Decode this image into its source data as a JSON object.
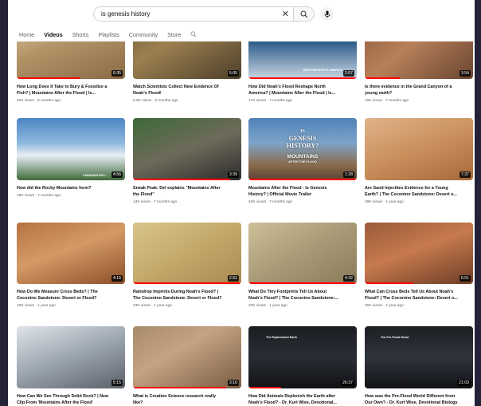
{
  "search": {
    "query": "is genesis history"
  },
  "tabs": [
    "Home",
    "Videos",
    "Shorts",
    "Playlists",
    "Community",
    "Store"
  ],
  "videos": [
    {
      "duration": "6:35",
      "title1": "How Long Does It Take to Bury & Fossilize a",
      "title2": "Fish? | Mountains After the Flood | Is...",
      "views": "40K views",
      "age": "6 months ago"
    },
    {
      "duration": "5:05",
      "title1": "Watch Scientists Collect New Evidence Of",
      "title2": "Noah's Flood!",
      "views": "6.9K views",
      "age": "6 months ago"
    },
    {
      "duration": "2:07",
      "title1": "How Did Noah's Flood Reshape North",
      "title2": "America? | Mountains After the Flood | Is...",
      "views": "17K views",
      "age": "7 months ago"
    },
    {
      "duration": "3:54",
      "title1": "Is there evidence in the Grand Canyon of a",
      "title2": "young earth?",
      "views": "10K views",
      "age": "7 months ago"
    },
    {
      "duration": "4:56",
      "title1": "How did the Rocky Mountains form?",
      "title2": "",
      "views": "18K views",
      "age": "7 months ago"
    },
    {
      "duration": "3:39",
      "title1": "Sneak Peak: Del explains \"Mountains After",
      "title2": "the Flood\"",
      "views": "13K views",
      "age": "7 months ago"
    },
    {
      "duration": "1:28",
      "title1": "Mountains After the Flood - Is Genesis",
      "title2": "History? | Official Movie Trailer",
      "views": "42K views",
      "age": "7 months ago"
    },
    {
      "duration": "7:37",
      "title1": "Are Sand Injectites Evidence for a Young",
      "title2": "Earth? | The Coconino Sandstone: Desert o...",
      "views": "29K views",
      "age": "1 year ago"
    },
    {
      "duration": "4:16",
      "title1": "How Do We Measure Cross Beds? | The",
      "title2": "Coconino Sandstone: Desert or Flood?",
      "views": "10K views",
      "age": "1 year ago"
    },
    {
      "duration": "2:51",
      "title1": "Raindrop Imprints During Noah's Flood? |",
      "title2": "The Coconino Sandstone: Desert or Flood?",
      "views": "23K views",
      "age": "1 year ago"
    },
    {
      "duration": "4:42",
      "title1": "What Do Tiny Footprints Tell Us About",
      "title2": "Noah's Flood? | The Coconino Sandstone:...",
      "views": "20K views",
      "age": "1 year ago"
    },
    {
      "duration": "6:51",
      "title1": "What Can Cross Beds Tell Us About Noah's",
      "title2": "Flood? | The Coconino Sandstone: Desert o...",
      "views": "30K views",
      "age": "1 year ago"
    },
    {
      "duration": "5:15",
      "title1": "How Can We See Through Solid Rock? | New",
      "title2": "Clip From 'Mountains After the Flood'",
      "views": "",
      "age": ""
    },
    {
      "duration": "3:16",
      "title1": "What is Creation Science research really",
      "title2": "like?",
      "views": "",
      "age": ""
    },
    {
      "duration": "26:37",
      "title1": "How Did Animals Replenish the Earth after",
      "title2": "Noah's Flood? - Dr. Kurt Wise, Devotional...",
      "views": "",
      "age": ""
    },
    {
      "duration": "21:03",
      "title1": "How was the Pre-Flood World Different from",
      "title2": "Our Own? - Dr. Kurt Wise, Devotional Biology",
      "views": "",
      "age": ""
    }
  ],
  "thumb_text": {
    "trailer_line1": "IS",
    "trailer_line2": "GENESIS",
    "trailer_line3": "HISTORY?",
    "trailer_line4": "MOUNTAINS",
    "trailer_line5": "AFTER THE FLOOD",
    "corner_3": "WESTERN NORTH AMERICA",
    "corner_5": "CANADIAN ROC...",
    "screen_15": "The Replenished Earth",
    "screen_16": "The Pre-Flood World"
  },
  "dot": " · ",
  "colors": {
    "accent_red": "#ff0000",
    "bg_dark": "#232238"
  }
}
